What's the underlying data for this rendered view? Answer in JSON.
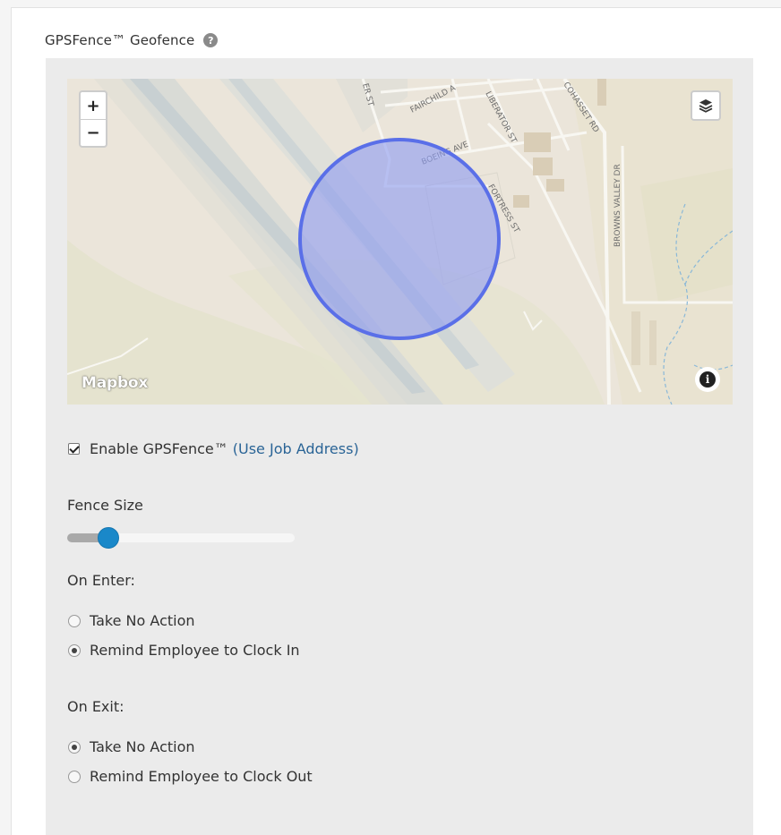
{
  "geofence": {
    "title": "GPSFence™ Geofence",
    "help_icon": "question-circle-icon"
  },
  "map": {
    "zoom_in_label": "+",
    "zoom_out_label": "−",
    "layers_icon": "layers-icon",
    "logo_text": "Mapbox",
    "info_icon": "info-icon",
    "info_label": "i",
    "streets": [
      {
        "name": "ER ST"
      },
      {
        "name": "FAIRCHILD A"
      },
      {
        "name": "LIBERATOR ST"
      },
      {
        "name": "COHASSET RD"
      },
      {
        "name": "BOEING AVE"
      },
      {
        "name": "FORTRESS ST"
      },
      {
        "name": "BROWNS VALLEY DR"
      }
    ],
    "fence_color": "#6373e6"
  },
  "enable": {
    "label": "Enable GPSFence™",
    "link": "(Use Job Address)",
    "checked": true
  },
  "fence_size": {
    "label": "Fence Size",
    "value_fraction": 0.18
  },
  "on_enter": {
    "label": "On Enter:",
    "options": [
      {
        "label": "Take No Action",
        "checked": false
      },
      {
        "label": "Remind Employee to Clock In",
        "checked": true
      }
    ]
  },
  "on_exit": {
    "label": "On Exit:",
    "options": [
      {
        "label": "Take No Action",
        "checked": true
      },
      {
        "label": "Remind Employee to Clock Out",
        "checked": false
      }
    ]
  },
  "colors": {
    "accent": "#1a88c9",
    "link": "#2a6496",
    "panel": "#ebebeb"
  }
}
